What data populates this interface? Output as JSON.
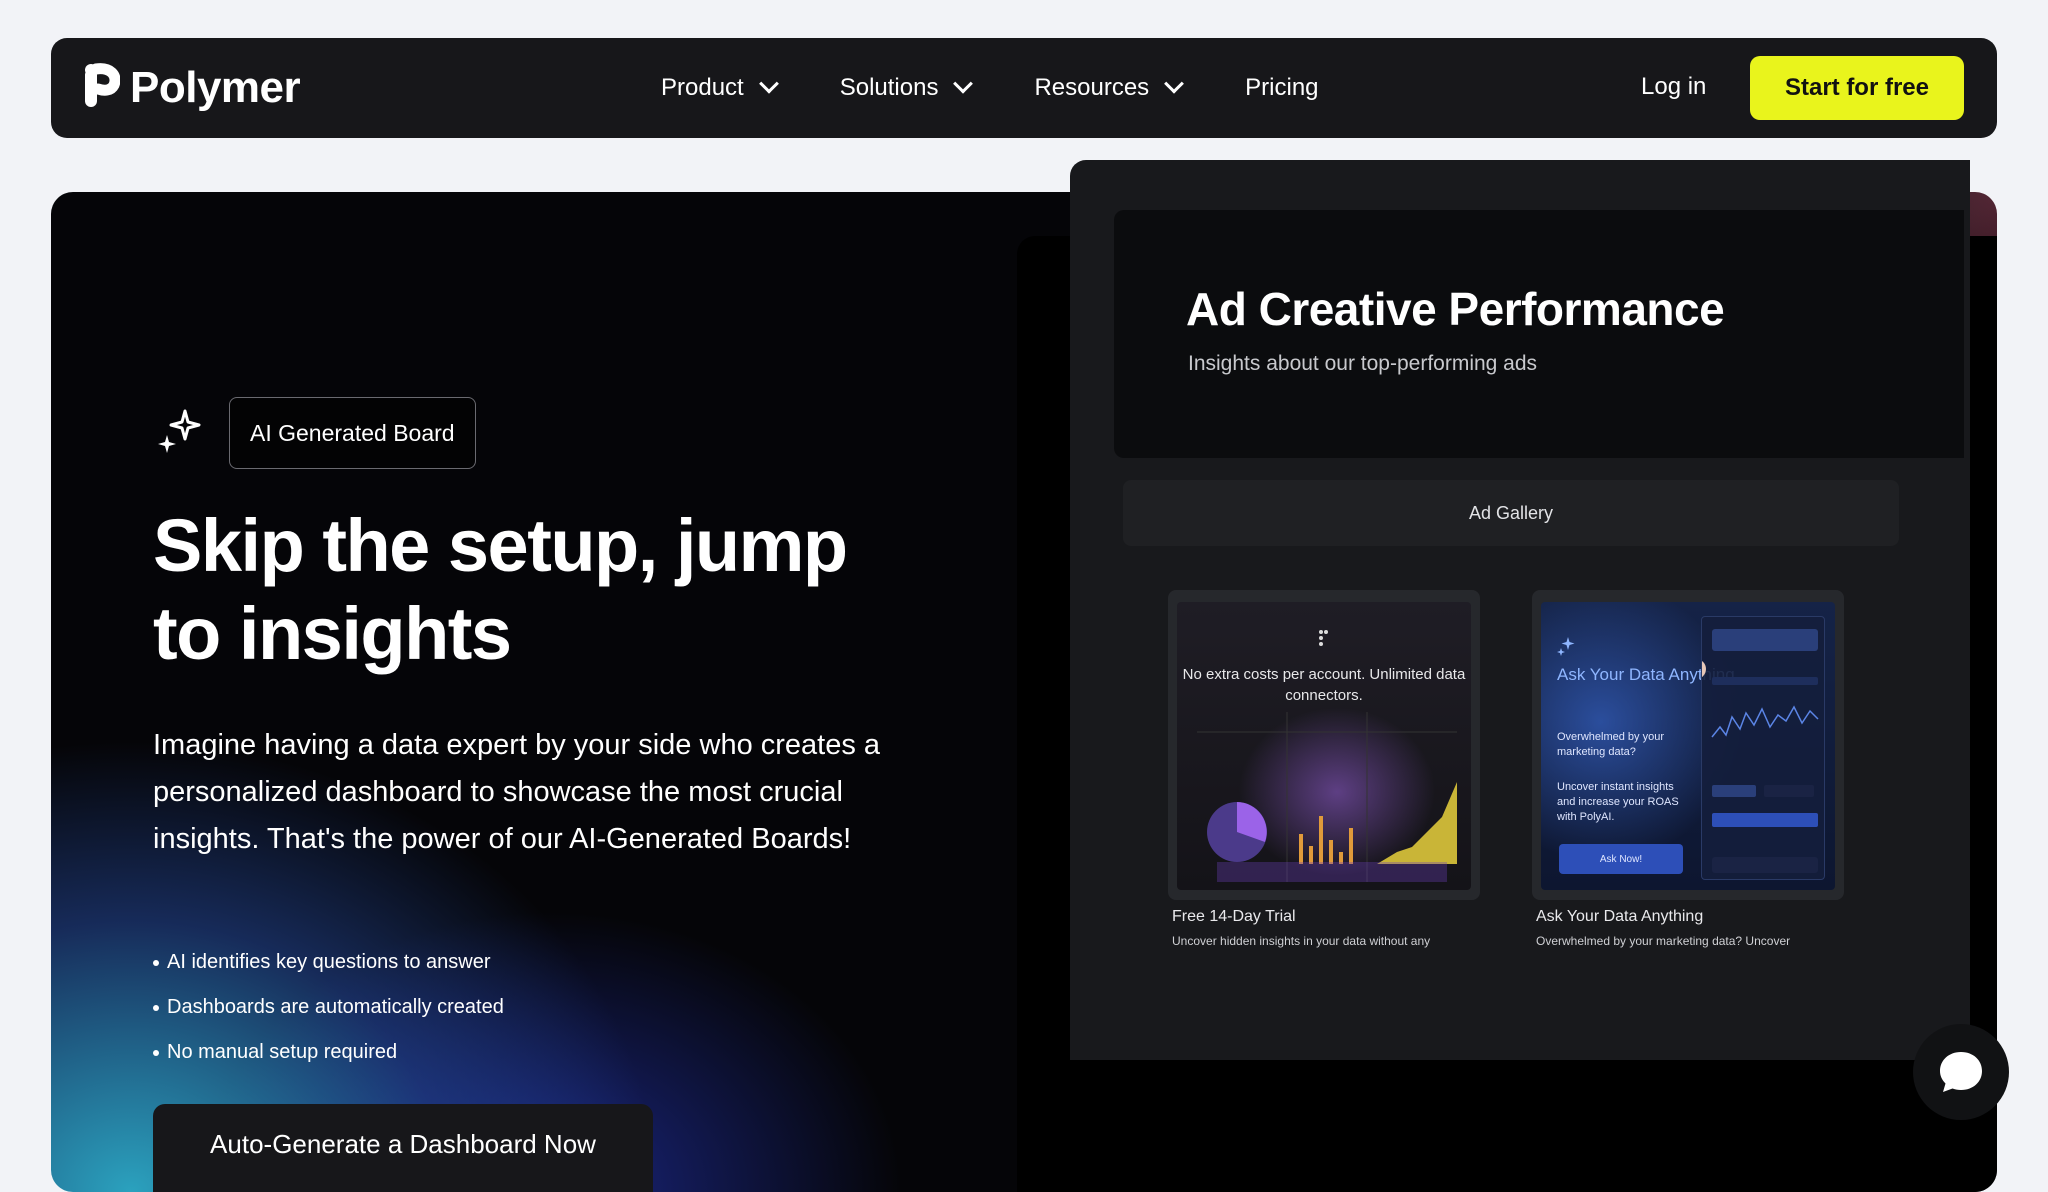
{
  "nav": {
    "brand": "Polymer",
    "items": [
      {
        "label": "Product"
      },
      {
        "label": "Solutions"
      },
      {
        "label": "Resources"
      },
      {
        "label": "Pricing"
      }
    ],
    "login": "Log in",
    "cta": "Start for free",
    "cta_color": "#e9f41c"
  },
  "hero": {
    "badge": "AI Generated Board",
    "headline": "Skip the setup, jump to insights",
    "description": "Imagine having a data expert by your side who creates a personalized dashboard to showcase the most crucial insights. That's the power of our AI-Generated Boards!",
    "bullets": [
      "AI identifies key questions to answer",
      "Dashboards are automatically created",
      "No manual setup required"
    ],
    "cta": "Auto-Generate a Dashboard Now"
  },
  "preview": {
    "title": "Ad Creative Performance",
    "subtitle": "Insights about our top-performing ads",
    "gallery_label": "Ad Gallery",
    "ads": [
      {
        "image_text": "No extra costs per account. Unlimited data connectors.",
        "caption": "Free 14-Day Trial",
        "description": "Uncover hidden insights in your data without any"
      },
      {
        "image_title": "Ask Your Data Anything",
        "image_sub1": "Overwhelmed by your marketing data?",
        "image_sub2": "Uncover instant insights and increase your ROAS with PolyAI.",
        "image_button": "Ask Now!",
        "caption": "Ask Your Data Anything",
        "description": "Overwhelmed by your marketing data? Uncover"
      }
    ]
  },
  "icons": {
    "chat": "chat-bubble-icon",
    "sparkle": "sparkle-icon",
    "chevron": "chevron-down-icon"
  }
}
